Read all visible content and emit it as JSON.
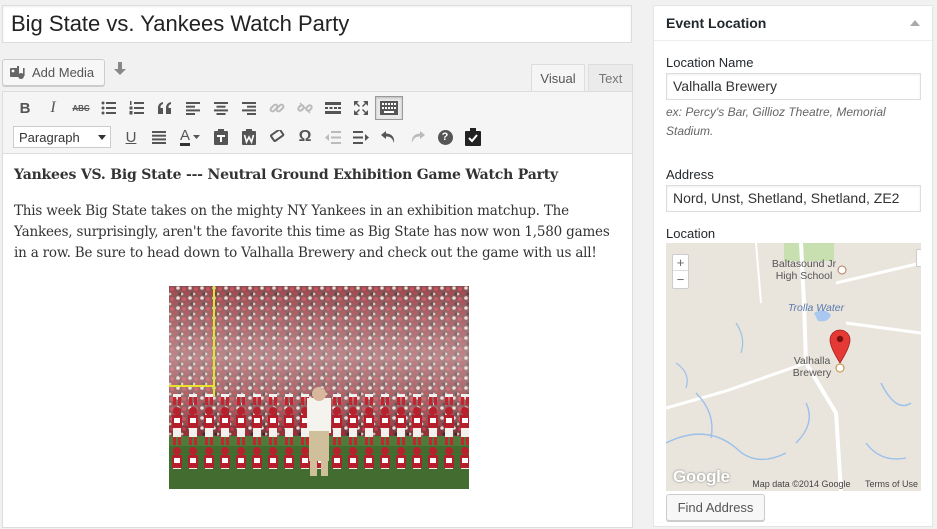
{
  "post": {
    "title": "Big State vs. Yankees Watch Party"
  },
  "media": {
    "add_media_label": "Add Media"
  },
  "tabs": [
    {
      "label": "Visual"
    },
    {
      "label": "Text"
    }
  ],
  "toolbar": {
    "format_select": "Paragraph",
    "row1_icons": [
      "bold-icon",
      "italic-icon",
      "strikethrough-icon",
      "bulleted-list-icon",
      "numbered-list-icon",
      "blockquote-icon",
      "align-left-icon",
      "align-center-icon",
      "align-right-icon",
      "link-icon",
      "unlink-icon",
      "read-more-icon",
      "fullscreen-icon",
      "toolbar-toggle-icon"
    ],
    "row2_icons": [
      "underline-icon",
      "justify-icon",
      "text-color-icon",
      "paste-text-icon",
      "paste-word-icon",
      "clear-format-icon",
      "special-char-icon",
      "outdent-icon",
      "indent-icon",
      "undo-icon",
      "redo-icon",
      "help-icon",
      "custom-insert-icon"
    ],
    "labels": {
      "bold": "B",
      "italic": "I",
      "strike": "ABC",
      "underline": "U",
      "text_color": "A",
      "special_char": "Ω",
      "help": "?"
    }
  },
  "content": {
    "heading": "Yankees VS. Big State --- Neutral Ground Exhibition Game Watch Party",
    "paragraph": "This week Big State takes on the mighty NY Yankees in an exhibition matchup. The Yankees, surprisingly, aren't the favorite this time as Big State has now won 1,580 games in a row. Be sure to head down to Valhalla Brewery and check out the game with us all!"
  },
  "sidebar": {
    "title": "Event Location",
    "location_name_label": "Location Name",
    "location_name_value": "Valhalla Brewery",
    "location_hint": "ex: Percy's Bar, Gillioz Theatre, Memorial Stadium.",
    "address_label": "Address",
    "address_value": "Nord, Unst, Shetland, Shetland, ZE2",
    "location_label": "Location",
    "find_button": "Find Address"
  },
  "map": {
    "labels": {
      "school": "Baltasound Jr\nHigh School",
      "water": "Trolla Water",
      "brewery": "Valhalla\nBrewery"
    },
    "zoom_in": "+",
    "zoom_out": "−",
    "logo": "Google",
    "copyright": "Map data ©2014 Google",
    "terms": "Terms of Use"
  },
  "colors": {
    "pin": "#e53935",
    "water": "#a9c8f0",
    "park": "#c8dfb0"
  }
}
